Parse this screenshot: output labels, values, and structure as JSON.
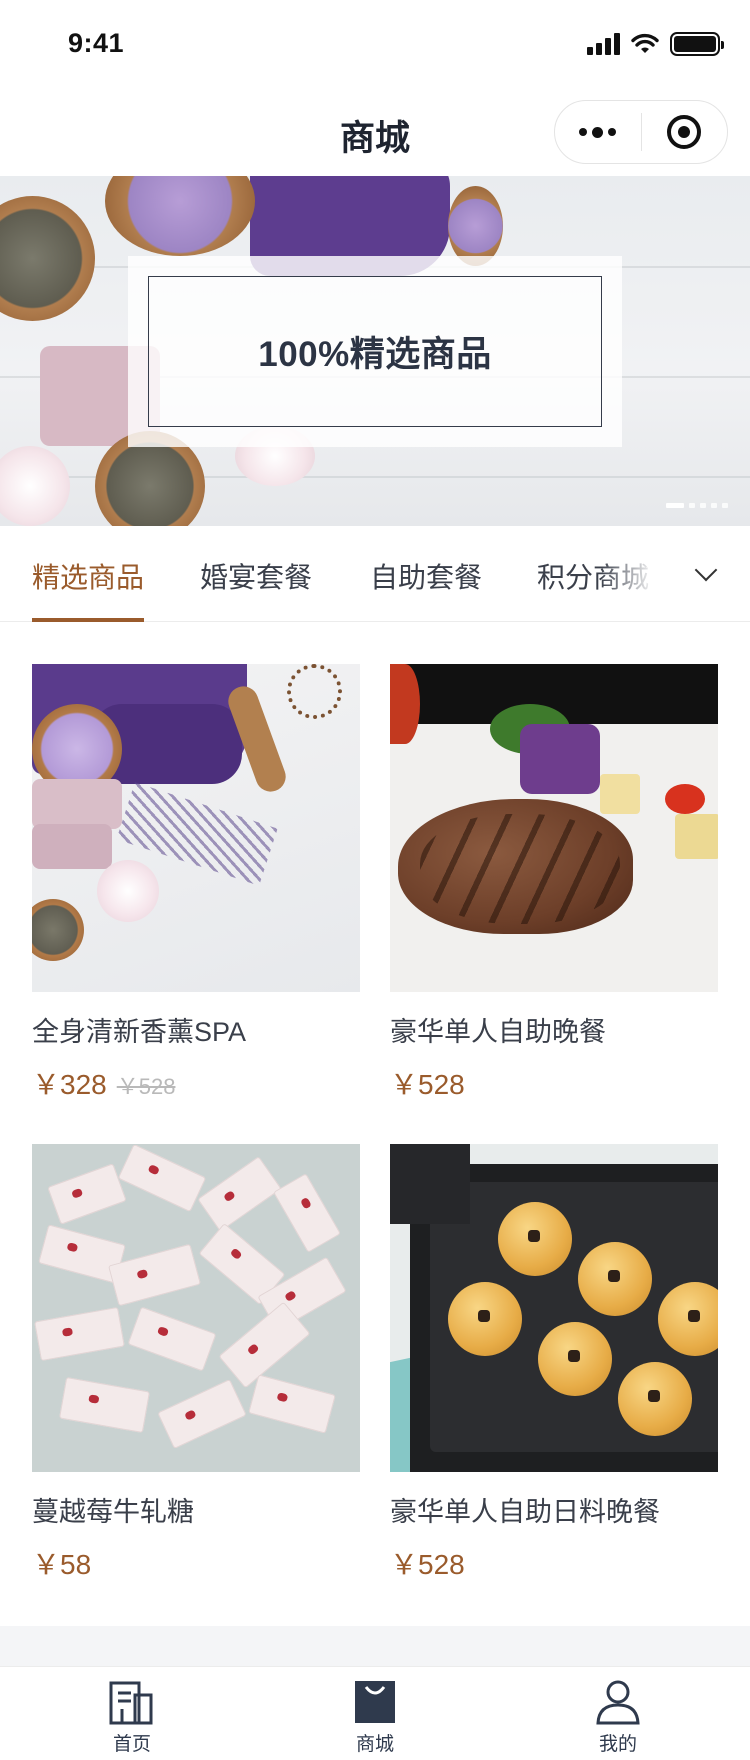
{
  "status_bar": {
    "time": "9:41"
  },
  "nav": {
    "title": "商城",
    "menu_icon": "more-dots-icon",
    "close_icon": "target-icon"
  },
  "banner": {
    "text": "100%精选商品",
    "slide_count": 5,
    "active_slide": 1
  },
  "tabs": [
    {
      "label": "精选商品",
      "active": true
    },
    {
      "label": "婚宴套餐",
      "active": false
    },
    {
      "label": "自助套餐",
      "active": false
    },
    {
      "label": "积分商城",
      "active": false
    }
  ],
  "products": [
    {
      "name": "全身清新香薰SPA",
      "price": "￥328",
      "original_price": "￥528"
    },
    {
      "name": "豪华单人自助晚餐",
      "price": "￥528"
    },
    {
      "name": "蔓越莓牛轧糖",
      "price": "￥58"
    },
    {
      "name": "豪华单人自助日料晚餐",
      "price": "￥528"
    }
  ],
  "tabbar": [
    {
      "label": "首页",
      "icon": "home-icon"
    },
    {
      "label": "商城",
      "icon": "shopping-bag-icon",
      "active": true
    },
    {
      "label": "我的",
      "icon": "user-icon"
    }
  ],
  "colors": {
    "accent": "#9a5b2c",
    "text": "#3a3f4a",
    "tabbar_icon": "#2f3a4d"
  }
}
